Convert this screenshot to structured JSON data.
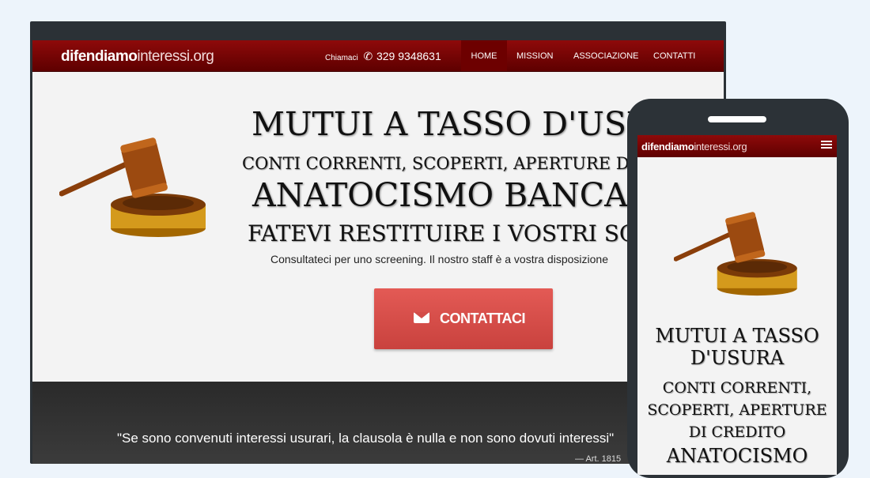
{
  "site": {
    "logo_bold": "difendiamo",
    "logo_rest": "interessi.org"
  },
  "desktop": {
    "call_label": "Chiamaci",
    "phone_number": "329 9348631",
    "nav": [
      "HOME",
      "MISSION",
      "ASSOCIAZIONE",
      "CONTATTI"
    ],
    "headline_1": "MUTUI A TASSO D'USURA",
    "headline_2": "CONTI CORRENTI, SCOPERTI, APERTURE DI CREDITO",
    "headline_3": "ANATOCISMO BANCARIO",
    "headline_4": "FATEVI RESTITUIRE I VOSTRI SOLDI",
    "subtext": "Consultateci per uno screening. Il nostro staff è a vostra disposizione",
    "cta_label": "CONTATTACI",
    "quote": "\"Se sono convenuti interessi usurari, la clausola è nulla e non sono dovuti interessi\"",
    "quote_cite": "— Art. 1815"
  },
  "mobile": {
    "headline_1": "MUTUI A TASSO D'USURA",
    "headline_2": "CONTI CORRENTI, SCOPERTI, APERTURE DI CREDITO",
    "headline_3": "ANATOCISMO"
  },
  "colors": {
    "nav_red": "#7a0505",
    "cta_red": "#d34d49",
    "frame": "#2b3136",
    "background": "#edf4fb"
  },
  "icons": [
    "phone-icon",
    "envelope-icon",
    "gavel-icon",
    "hamburger-menu-icon"
  ]
}
